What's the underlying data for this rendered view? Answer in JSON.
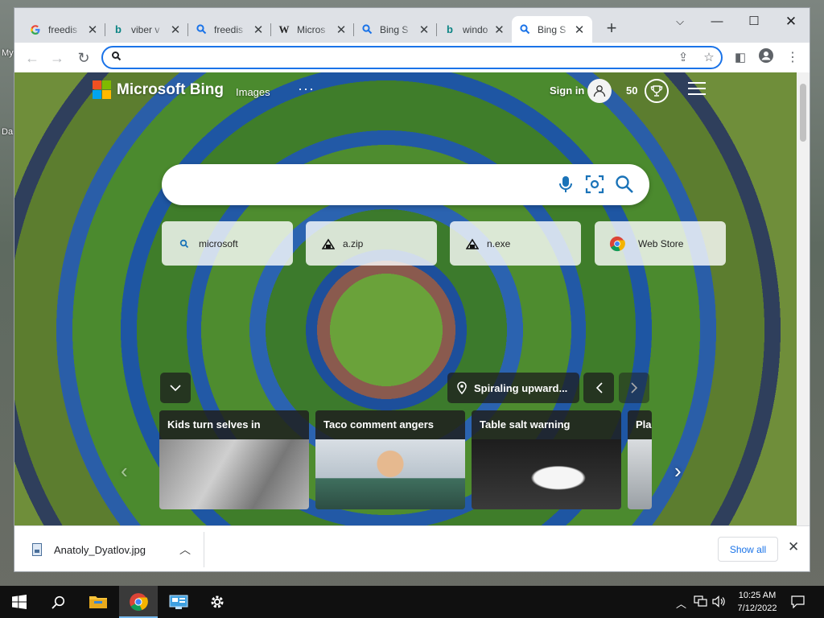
{
  "desktop": {
    "labels": [
      "My",
      "Da"
    ]
  },
  "tabs": [
    {
      "title": "freedis",
      "icon": "google-icon"
    },
    {
      "title": "viber v",
      "icon": "bing-icon"
    },
    {
      "title": "freedis",
      "icon": "search-icon"
    },
    {
      "title": "Micros",
      "icon": "wikipedia-icon"
    },
    {
      "title": "Bing S",
      "icon": "search-icon"
    },
    {
      "title": "windo",
      "icon": "bing-icon"
    },
    {
      "title": "Bing S",
      "icon": "search-icon",
      "active": true
    }
  ],
  "omnibox": {
    "value": ""
  },
  "bing": {
    "brand": "Microsoft Bing",
    "nav_images": "Images",
    "nav_more": "···",
    "signin": "Sign in",
    "points": "50",
    "search_placeholder": "",
    "tiles": [
      {
        "label": "microsoft",
        "icon": "search-icon"
      },
      {
        "label": "a.zip",
        "icon": "file-icon"
      },
      {
        "label": "n.exe",
        "icon": "file-icon"
      },
      {
        "label": "Web Store",
        "icon": "chrome-icon"
      }
    ],
    "image_title": "Spiraling upward...",
    "news": [
      {
        "title": "Kids turn selves in"
      },
      {
        "title": "Taco comment angers"
      },
      {
        "title": "Table salt warning"
      },
      {
        "title": "Plan"
      }
    ]
  },
  "downloads": {
    "file": "Anatoly_Dyatlov.jpg",
    "show_all": "Show all"
  },
  "taskbar": {
    "time": "10:25 AM",
    "date": "7/12/2022"
  },
  "colors": {
    "accent": "#1a73e8",
    "bing_blue": "#1e56a3",
    "grass": "#4b8a2e"
  }
}
